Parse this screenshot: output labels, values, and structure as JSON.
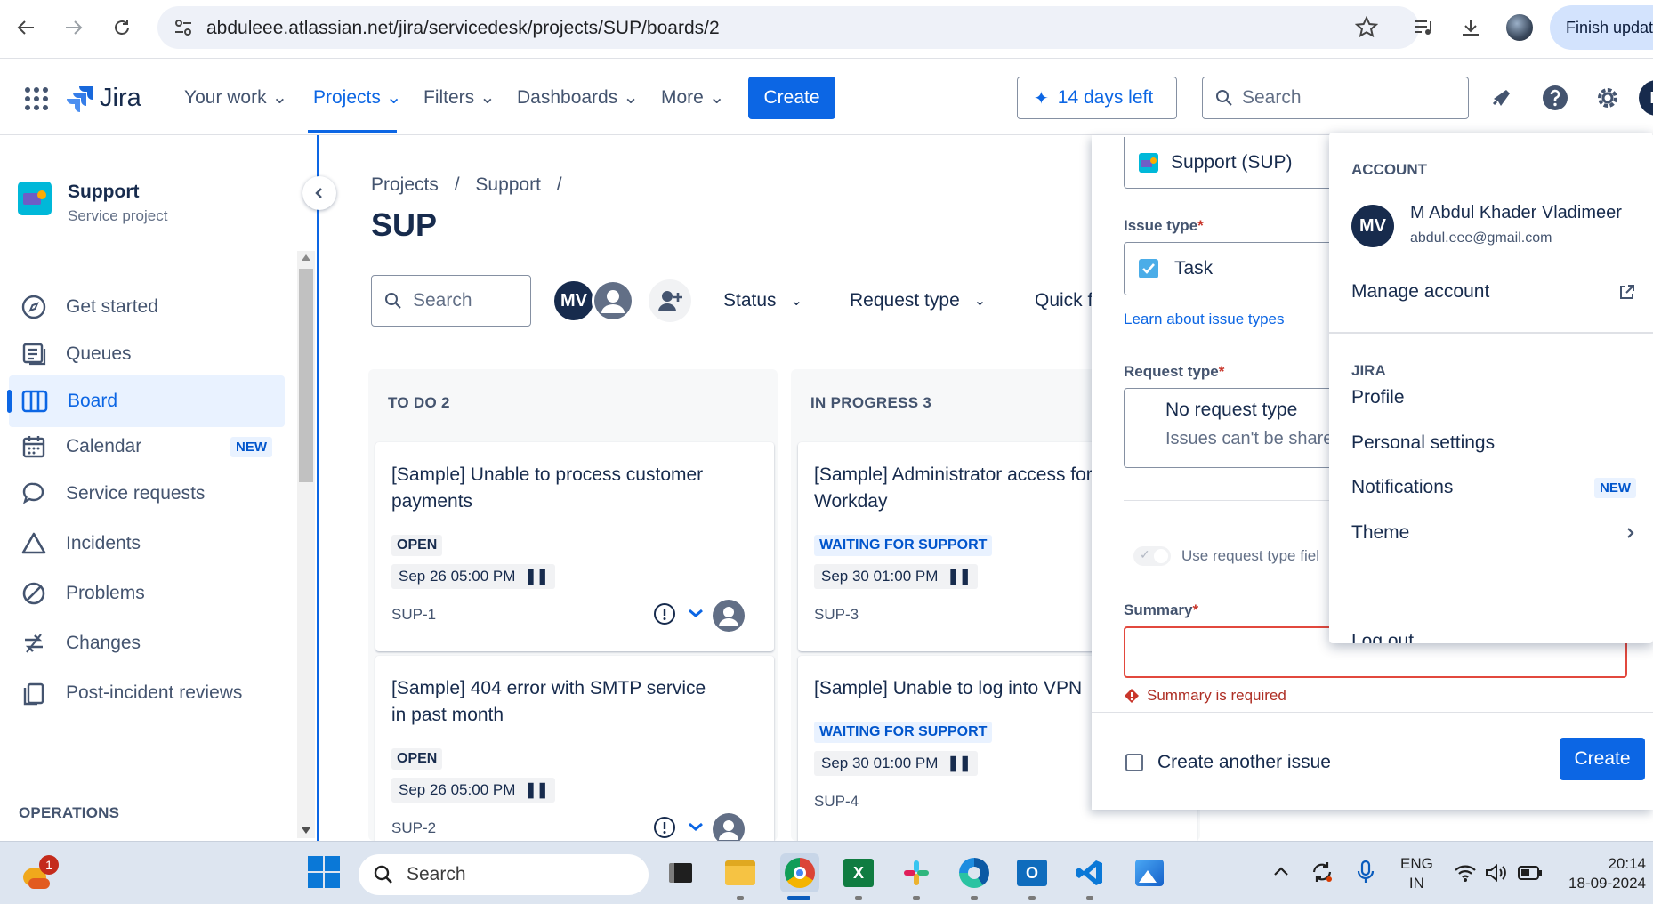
{
  "browser": {
    "url": "abduleee.atlassian.net/jira/servicedesk/projects/SUP/boards/2",
    "finish_update": "Finish updat"
  },
  "topnav": {
    "product": "Jira",
    "items": [
      "Your work",
      "Projects",
      "Filters",
      "Dashboards",
      "More"
    ],
    "active": "Projects",
    "create": "Create",
    "trial": "14 days left",
    "search_placeholder": "Search",
    "profile_initial": "M"
  },
  "sidebar": {
    "project_name": "Support",
    "project_type": "Service project",
    "items": [
      {
        "label": "Get started",
        "icon": "compass-icon"
      },
      {
        "label": "Queues",
        "icon": "queue-icon"
      },
      {
        "label": "Board",
        "icon": "board-icon",
        "active": true
      },
      {
        "label": "Calendar",
        "icon": "calendar-icon",
        "badge": "NEW"
      },
      {
        "label": "Service requests",
        "icon": "chat-icon"
      },
      {
        "label": "Incidents",
        "icon": "warning-icon"
      },
      {
        "label": "Problems",
        "icon": "ban-icon"
      },
      {
        "label": "Changes",
        "icon": "change-icon"
      },
      {
        "label": "Post-incident reviews",
        "icon": "pages-icon"
      }
    ],
    "section": "OPERATIONS"
  },
  "main": {
    "breadcrumb": [
      "Projects",
      "Support"
    ],
    "title": "SUP",
    "search_placeholder": "Search",
    "user_initials": "MV",
    "filters": [
      "Status",
      "Request type",
      "Quick f"
    ]
  },
  "board": {
    "columns": [
      {
        "title": "TO DO 2",
        "cards": [
          {
            "title": "[Sample] Unable to process customer payments",
            "status": "OPEN",
            "due": "Sep 26 05:00 PM",
            "key": "SUP-1"
          },
          {
            "title": "[Sample] 404 error with SMTP service in past month",
            "status": "OPEN",
            "due": "Sep 26 05:00 PM",
            "key": "SUP-2"
          }
        ]
      },
      {
        "title": "IN PROGRESS 3",
        "cards": [
          {
            "title": "[Sample] Administrator access for Workday",
            "status": "WAITING FOR SUPPORT",
            "due": "Sep 30 01:00 PM",
            "key": "SUP-3"
          },
          {
            "title": "[Sample] Unable to log into VPN",
            "status": "WAITING FOR SUPPORT",
            "due": "Sep 30 01:00 PM",
            "key": "SUP-4"
          }
        ]
      }
    ]
  },
  "create_modal": {
    "project_value": "Support (SUP)",
    "issue_type_label": "Issue type",
    "issue_type_value": "Task",
    "issue_type_link": "Learn about issue types",
    "request_type_label": "Request type",
    "request_type_value": "No request type",
    "request_type_hint": "Issues can't be share",
    "toggle_label": "Use request type fiel",
    "summary_label": "Summary",
    "summary_error": "Summary is required",
    "required_mark": "*",
    "create_another": "Create another issue",
    "create": "Create"
  },
  "account_menu": {
    "section_account": "ACCOUNT",
    "user_initials": "MV",
    "user_name": "M Abdul Khader Vladimeer",
    "user_email": "abdul.eee@gmail.com",
    "manage_account": "Manage account",
    "section_jira": "JIRA",
    "profile": "Profile",
    "personal_settings": "Personal settings",
    "notifications": "Notifications",
    "notifications_badge": "NEW",
    "theme": "Theme",
    "logout": "Log out"
  },
  "taskbar": {
    "search_placeholder": "Search",
    "notification_count": "1",
    "lang_top": "ENG",
    "lang_bottom": "IN",
    "time": "20:14",
    "date": "18-09-2024"
  },
  "colors": {
    "brand_blue": "#0c66e4",
    "error_red": "#c9372c",
    "avatar_navy": "#172b4d"
  }
}
